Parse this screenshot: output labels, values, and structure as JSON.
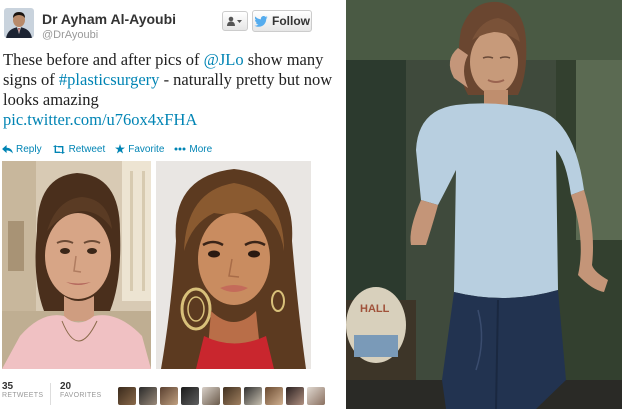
{
  "tweet": {
    "author_name": "Dr Ayham Al-Ayoubi",
    "author_handle": "@DrAyoubi",
    "follow_label": "Follow",
    "text_before_mention": "These before and after pics of ",
    "mention": "@JLo",
    "text_after_mention": " show many signs of ",
    "hashtag": "#plasticsurgery",
    "text_after_hashtag": " - naturally pretty but now looks amazing",
    "link": "pic.twitter.com/u76ox4xFHA"
  },
  "actions": {
    "reply": "Reply",
    "retweet": "Retweet",
    "favorite": "Favorite",
    "more": "More"
  },
  "stats": {
    "retweets_count": "35",
    "retweets_label": "RETWEETS",
    "favorites_count": "20",
    "favorites_label": "FAVORITES"
  },
  "icons": {
    "twitter_bird": "twitter-bird-icon",
    "user_menu": "user-menu-icon",
    "reply": "reply-icon",
    "retweet": "retweet-icon",
    "favorite": "star-icon",
    "more": "more-dots-icon"
  },
  "colors": {
    "link": "#0084b4",
    "name": "#333333",
    "handle": "#999999",
    "twitter_blue": "#55acee"
  }
}
